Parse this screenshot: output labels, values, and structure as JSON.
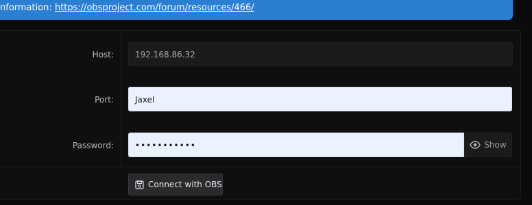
{
  "banner": {
    "prefix": "nformation:",
    "link_text": "https://obsproject.com/forum/resources/466/"
  },
  "form": {
    "host": {
      "label": "Host:",
      "value": "192.168.86.32"
    },
    "port": {
      "label": "Port:",
      "value": "Jaxel"
    },
    "password": {
      "label": "Password:",
      "value": "•••••••••••",
      "show_label": "Show"
    }
  },
  "actions": {
    "connect_label": "Connect with OBS"
  },
  "icons": {
    "show": "eye-icon",
    "connect": "save-icon"
  },
  "colors": {
    "banner": "#2b7fd3",
    "input_light": "#eaf2ff",
    "panel": "#0f0f10"
  }
}
